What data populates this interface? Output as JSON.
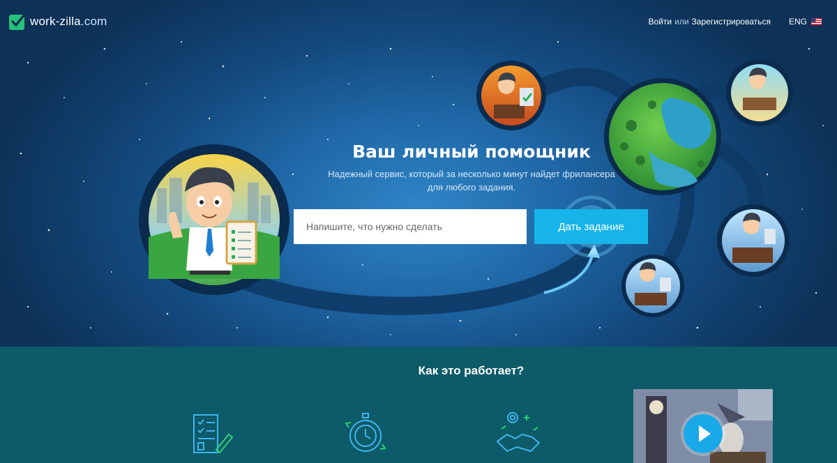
{
  "header": {
    "logo_text": "work-zilla",
    "logo_suffix": ".com",
    "login_label": "Войти",
    "or_label": "или",
    "register_label": "Зарегистрироваться",
    "language_label": "ENG"
  },
  "hero": {
    "title": "Ваш личный помощник",
    "subtitle": "Надежный сервис, который за несколько минут найдет фрилансера для любого задания.",
    "input_placeholder": "Напишите, что нужно сделать",
    "input_value": "",
    "submit_label": "Дать задание"
  },
  "how_it_works": {
    "title": "Как это работает?",
    "steps": [
      {
        "icon": "checklist-document-icon"
      },
      {
        "icon": "stopwatch-icon"
      },
      {
        "icon": "handshake-icon"
      }
    ],
    "video_icon": "play-icon"
  },
  "colors": {
    "accent": "#16b4e9",
    "logo_green": "#22c27a",
    "section_bg": "#0d5a68"
  }
}
